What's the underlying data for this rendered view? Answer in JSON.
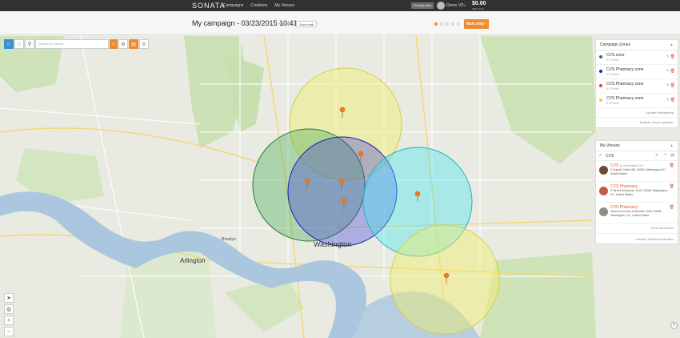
{
  "topbar": {
    "logo": "SONATA",
    "nav": [
      "Campaigns",
      "Creatives",
      "My Venues"
    ],
    "change_btn": "Change plan",
    "user": "Demo VD",
    "balance": "$0.00",
    "balance_label": "ADD funds"
  },
  "header": {
    "title": "My campaign - 03/23/2015 10:41",
    "modify": "Modify",
    "save_draft": "Save draft",
    "next_step": "Next step"
  },
  "toolbar": {
    "search_placeholder": "Search for places"
  },
  "map_labels": {
    "washington": "Washington",
    "arlington": "Arlington",
    "rosslyn": "Rosslyn"
  },
  "zones_panel": {
    "title": "Campaign Zones",
    "zones": [
      {
        "name": "CVS zone",
        "size": "5,279 feet",
        "color": "#2d7a2d"
      },
      {
        "name": "CVS Pharmacy zone",
        "size": "5,279 feet",
        "color": "#1e1eb4"
      },
      {
        "name": "CVS Pharmacy zone",
        "size": "5,279 feet",
        "color": "#e83c3c"
      },
      {
        "name": "CVS Pharmacy zone",
        "size": "5,279 feet",
        "color": "#e6d23c"
      }
    ],
    "footer1": "Update Retargeting",
    "footer2": "Multiple zones uploader"
  },
  "venues_panel": {
    "title": "My Venues",
    "search_value": "CVS",
    "venues": [
      {
        "name": "CVS",
        "handle": "@ MetroWashCVS",
        "address": "6 Dupont Circle NW, 20036, Washington DC, United States"
      },
      {
        "name": "CVS Pharmacy",
        "handle": "",
        "address": "P Street Northwest, 1418, 20005, Washington, DC, United States"
      },
      {
        "name": "CVS Pharmacy",
        "handle": "",
        "address": "Vermont Avenue Northwest, 1199, 20005, Washington, DC, United States"
      }
    ],
    "footer1": "Zone all venues",
    "footer2": "Disable Tracked Activation"
  },
  "help": "?"
}
